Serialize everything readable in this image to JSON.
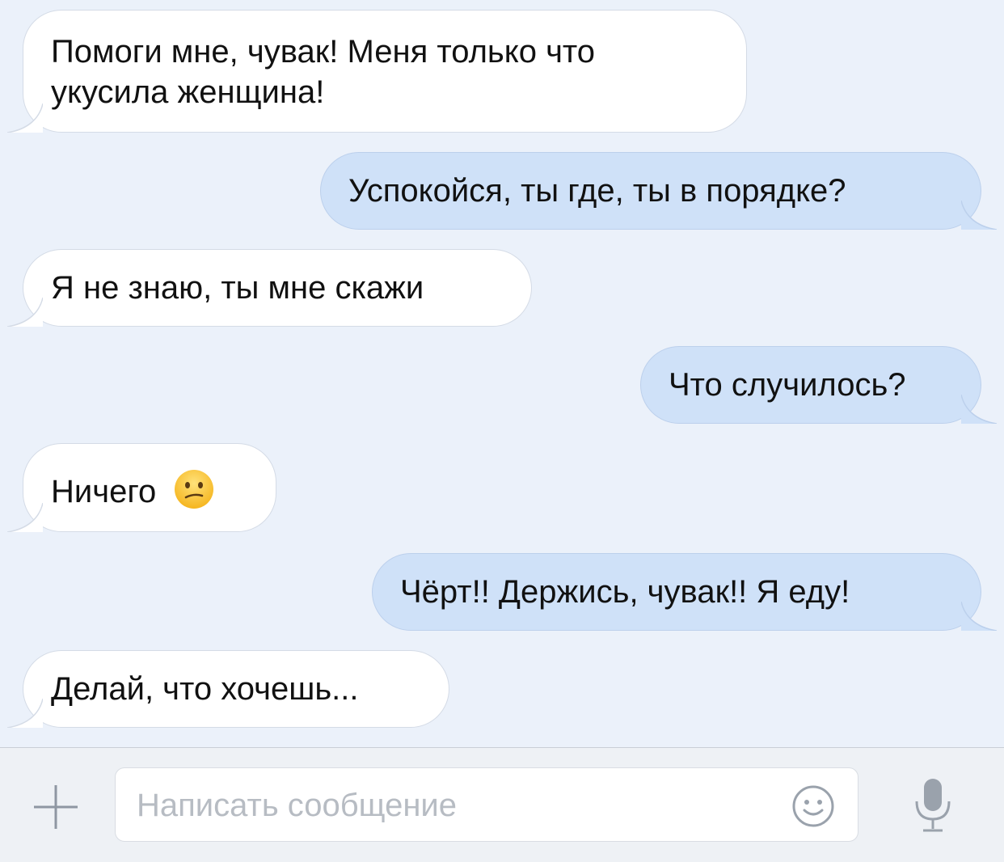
{
  "messages": [
    {
      "direction": "incoming",
      "text": "Помоги мне, чувак! Меня только что укусила женщина!"
    },
    {
      "direction": "outgoing",
      "text": "Успокойся, ты где, ты в порядке?"
    },
    {
      "direction": "incoming",
      "text": "Я не знаю, ты мне скажи"
    },
    {
      "direction": "outgoing",
      "text": "Что случилось?"
    },
    {
      "direction": "incoming",
      "text": "Ничего",
      "emoji": "confused-face-icon"
    },
    {
      "direction": "outgoing",
      "text": "Чёрт!! Держись, чувак!! Я еду!"
    },
    {
      "direction": "incoming",
      "text": "Делай, что хочешь..."
    }
  ],
  "composer": {
    "placeholder": "Написать сообщение",
    "value": "",
    "icons": {
      "attach": "plus-icon",
      "emoji": "smile-icon",
      "voice": "microphone-icon"
    }
  },
  "colors": {
    "background": "#ebf1fa",
    "incoming_bubble": "#ffffff",
    "outgoing_bubble": "#cfe1f8",
    "text": "#111111",
    "placeholder": "#b7bcc3",
    "icon": "#9aa2ac"
  }
}
